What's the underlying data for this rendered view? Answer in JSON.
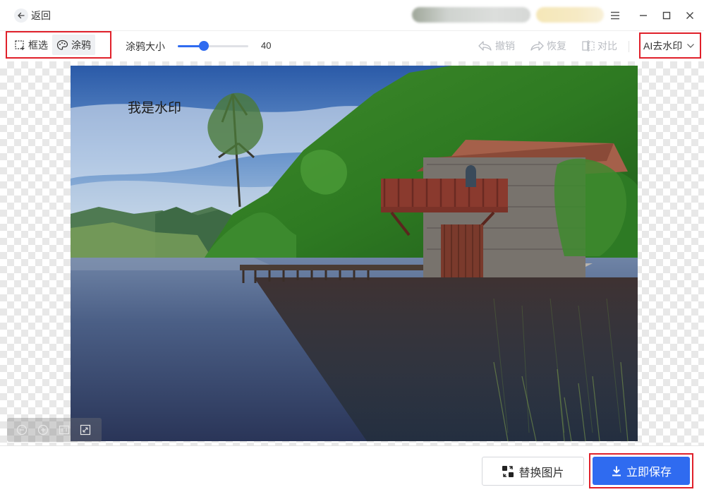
{
  "titlebar": {
    "back_label": "返回",
    "icons": {
      "back": "arrow-left-icon",
      "menu": "hamburger-menu-icon",
      "minimize": "minimize-icon",
      "maximize": "maximize-icon",
      "close": "close-icon"
    }
  },
  "toolbar": {
    "mode_buttons": [
      {
        "label": "框选",
        "icon": "marquee-select-icon",
        "active": false
      },
      {
        "label": "涂鸦",
        "icon": "palette-icon",
        "active": true
      }
    ],
    "brush_size_label": "涂鸦大小",
    "brush_size_value": "40",
    "brush_size_fraction": 0.37,
    "undo_label": "撤销",
    "redo_label": "恢复",
    "compare_label": "对比",
    "ai_select_value": "AI去水印"
  },
  "canvas": {
    "watermark_text": "我是水印",
    "zoom_controls": [
      "zoom-out-icon",
      "zoom-in-icon",
      "actual-size-icon",
      "fit-screen-icon"
    ]
  },
  "footer": {
    "replace_label": "替换图片",
    "save_label": "立即保存"
  },
  "colors": {
    "accent": "#2f6bf0",
    "highlight_border": "#e0202a",
    "disabled": "#b9bcc2"
  }
}
